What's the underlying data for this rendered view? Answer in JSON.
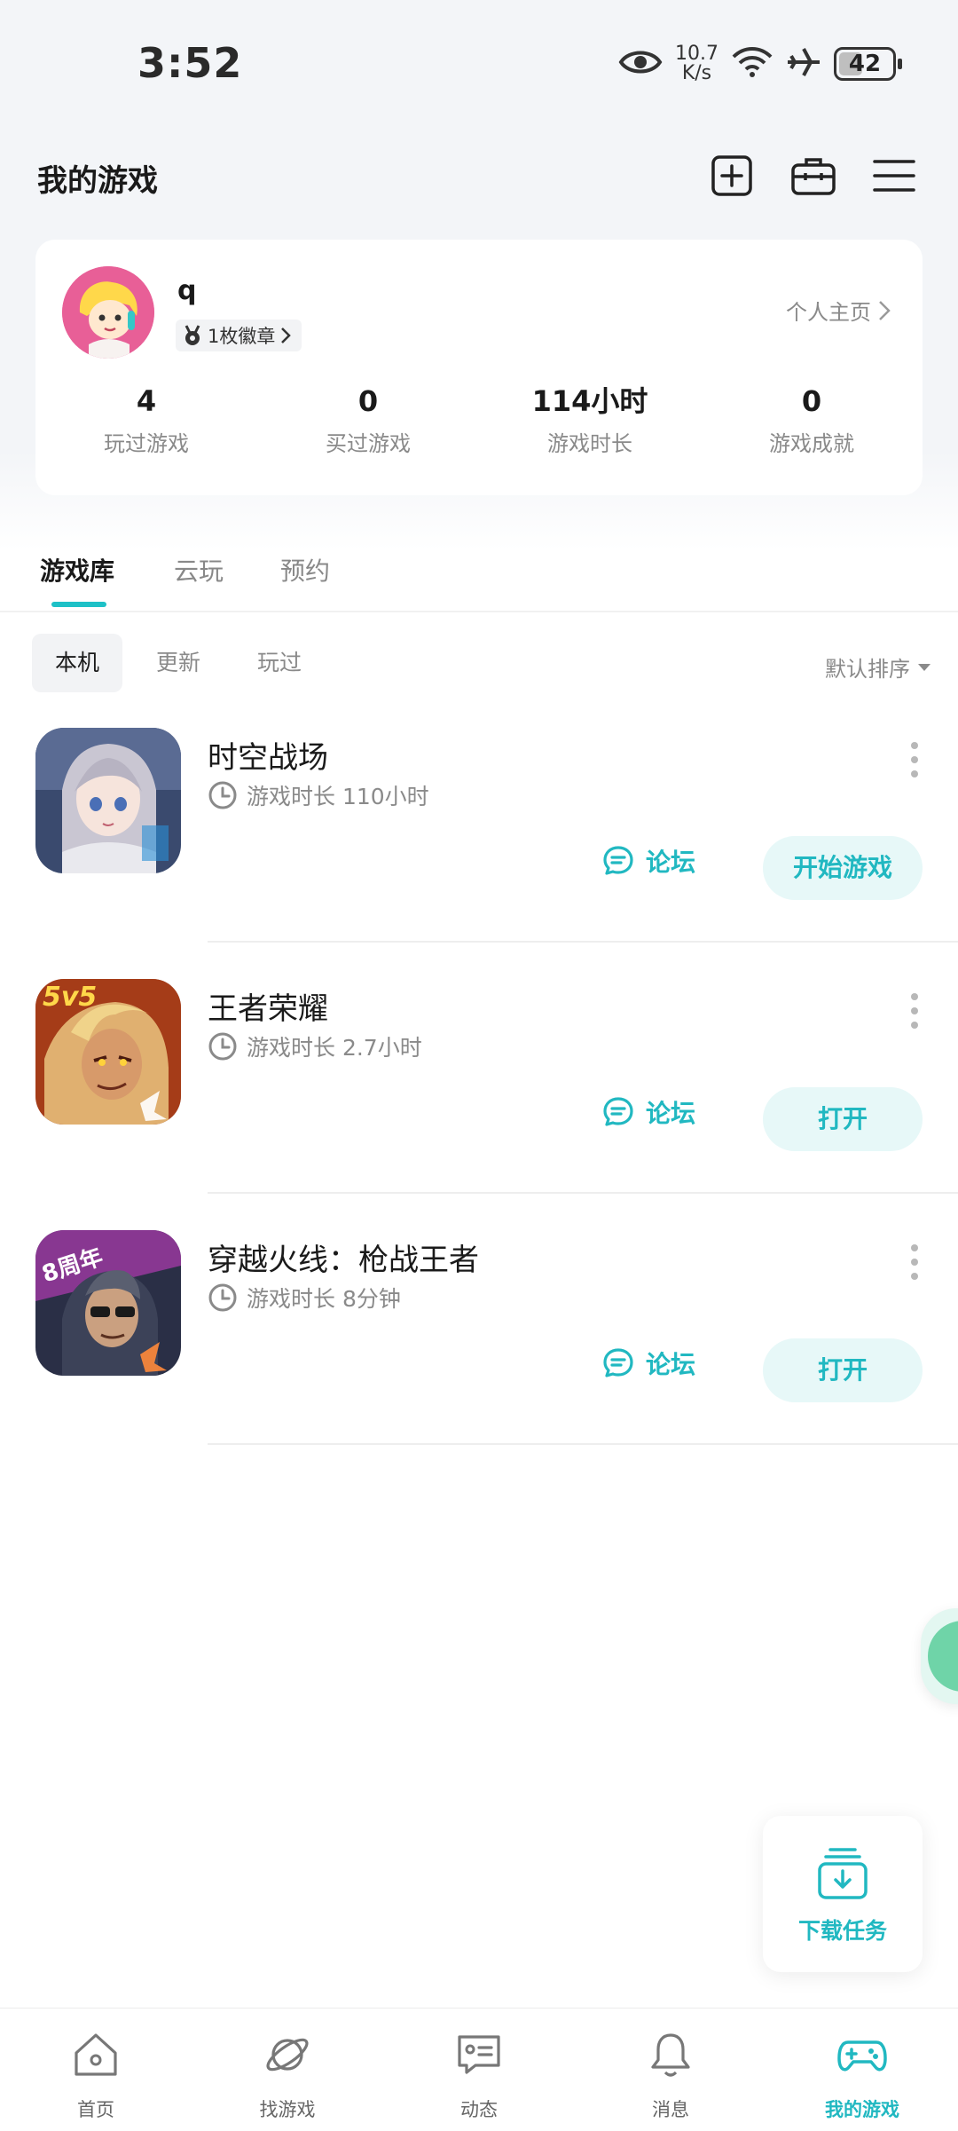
{
  "status_bar": {
    "time": "3:52",
    "net_speed_value": "10.7",
    "net_speed_unit": "K/s",
    "battery": "42"
  },
  "header": {
    "title": "我的游戏"
  },
  "profile": {
    "username": "q",
    "badge": "1枚徽章",
    "homepage_link": "个人主页",
    "stats": [
      {
        "value": "4",
        "label": "玩过游戏"
      },
      {
        "value": "0",
        "label": "买过游戏"
      },
      {
        "value": "114小时",
        "label": "游戏时长"
      },
      {
        "value": "0",
        "label": "游戏成就"
      }
    ]
  },
  "tabs": [
    "游戏库",
    "云玩",
    "预约"
  ],
  "filters": [
    "本机",
    "更新",
    "玩过"
  ],
  "sort_label": "默认排序",
  "games": [
    {
      "name": "时空战场",
      "playtime": "游戏时长 110小时",
      "forum": "论坛",
      "action": "开始游戏"
    },
    {
      "name": "王者荣耀",
      "playtime": "游戏时长 2.7小时",
      "forum": "论坛",
      "action": "打开"
    },
    {
      "name": "穿越火线：枪战王者",
      "playtime": "游戏时长 8分钟",
      "forum": "论坛",
      "action": "打开"
    }
  ],
  "download_task": {
    "label": "下载任务"
  },
  "bottom_nav": [
    {
      "label": "首页",
      "icon": "home-icon"
    },
    {
      "label": "找游戏",
      "icon": "planet-icon"
    },
    {
      "label": "动态",
      "icon": "feed-icon"
    },
    {
      "label": "消息",
      "icon": "bell-icon"
    },
    {
      "label": "我的游戏",
      "icon": "gamepad-icon"
    }
  ],
  "colors": {
    "accent": "#21b8c1",
    "accent_light": "#e7f8f8",
    "background": "#f3f5f8"
  }
}
